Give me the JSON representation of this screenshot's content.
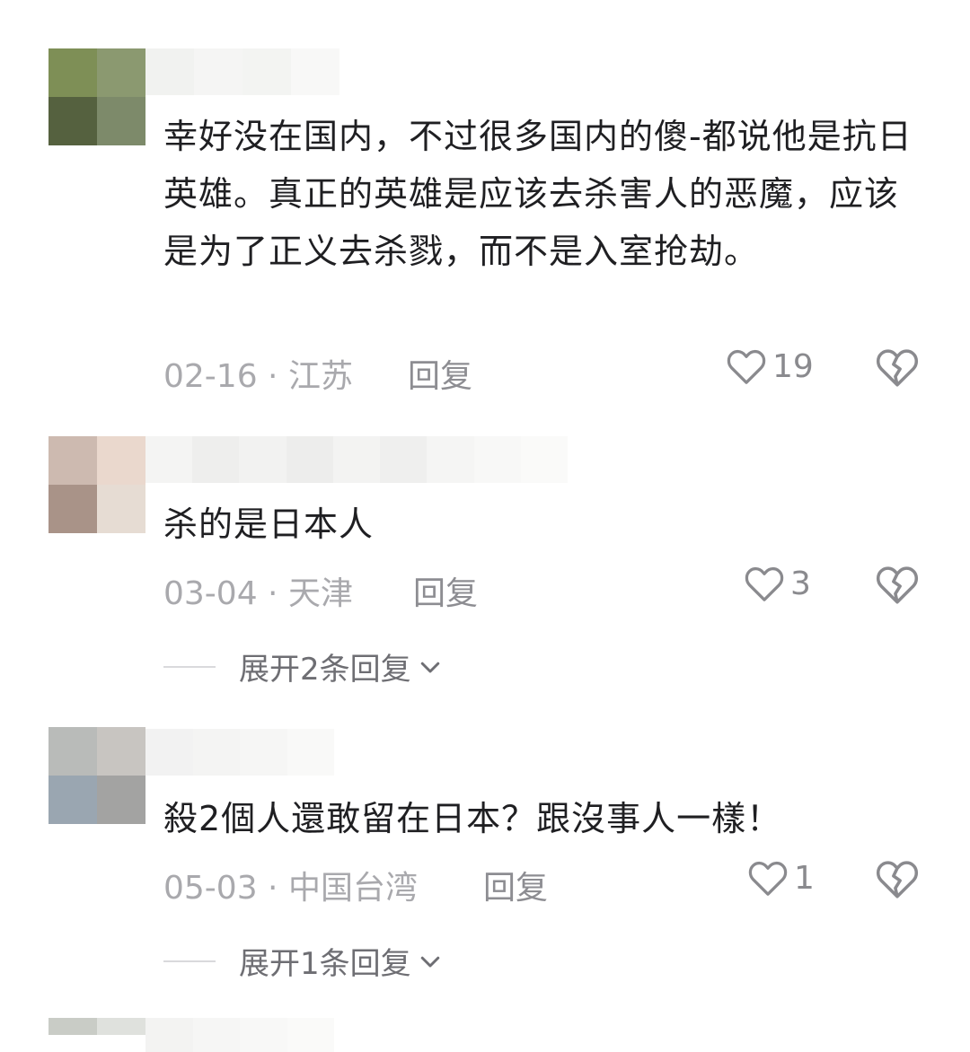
{
  "comments": [
    {
      "text": "幸好没在国内，不过很多国内的傻-都说他是抗日英雄。真正的英雄是应该去杀害人的恶魔，应该是为了正义去杀戮，而不是入室抢劫。",
      "date_location": "02-16 · 江苏",
      "reply_label": "回复",
      "likes": "19",
      "avatar_colors": [
        "#7e8f56",
        "#8b9970",
        "#55613f",
        "#7d8a6a"
      ]
    },
    {
      "text": "杀的是日本人",
      "date_location": "03-04 · 天津",
      "reply_label": "回复",
      "likes": "3",
      "expand_label": "展开2条回复",
      "avatar_colors": [
        "#cdbab0",
        "#ead8cd",
        "#a99388",
        "#e6dcd3"
      ]
    },
    {
      "text": "殺2個人還敢留在日本？跟沒事人一樣！",
      "date_location": "05-03 · 中国台湾",
      "reply_label": "回复",
      "likes": "1",
      "expand_label": "展开1条回复",
      "avatar_colors": [
        "#b9bbb9",
        "#c8c5c1",
        "#9aa6b1",
        "#a3a3a2"
      ]
    }
  ],
  "icons": {
    "like": "heart-outline-icon",
    "dislike": "broken-heart-icon",
    "expand": "chevron-down-icon"
  }
}
